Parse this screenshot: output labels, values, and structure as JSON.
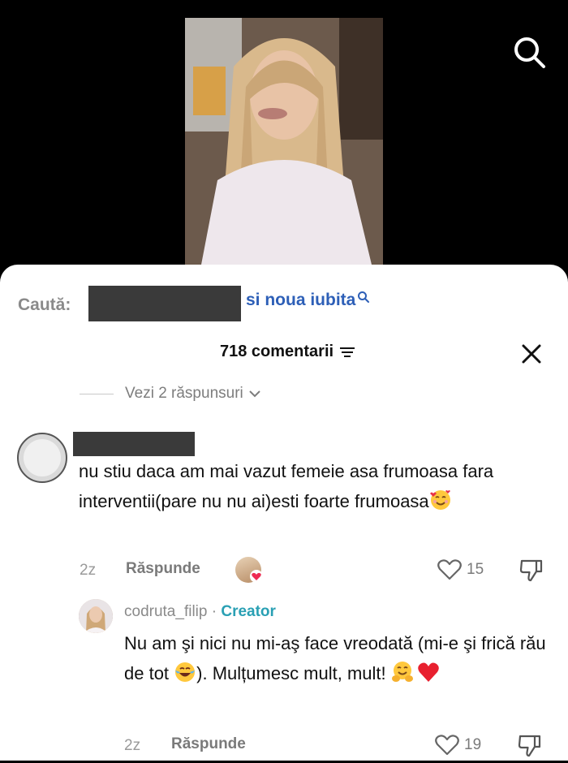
{
  "search": {
    "label": "Caută:",
    "term": "si noua iubita"
  },
  "comments": {
    "count_label": "718 comentarii",
    "view_replies": "Vezi 2 răspunsuri"
  },
  "comment": {
    "text": "nu stiu daca am mai vazut femeie asa frumoasa fara interventii(pare nu nu ai)esti foarte frumoasa",
    "time": "2z",
    "reply_label": "Răspunde",
    "likes": "15"
  },
  "reply": {
    "username": "codruta_filip",
    "separator": " · ",
    "badge": "Creator",
    "text": "Nu am şi nici nu mi-aş face vreodată (mi-e şi frică rău de tot ",
    "text_after": "). Mulțumesc mult, mult! ",
    "time": "2z",
    "reply_label": "Răspunde",
    "likes": "19"
  },
  "icons": {
    "search": "search-icon",
    "filter": "filter-icon",
    "close": "close-icon",
    "chevron": "chevron-down-icon",
    "like": "heart-outline-icon",
    "dislike": "thumbs-down-icon",
    "smiling_hearts": "smiling-face-with-hearts-emoji",
    "tears_of_joy": "face-with-tears-of-joy-emoji",
    "hugging": "hugging-face-emoji",
    "red_heart": "red-heart-emoji"
  },
  "colors": {
    "link_blue": "#2d5fb7",
    "creator_teal": "#2aa0b4",
    "muted_gray": "#7a7a7a"
  }
}
